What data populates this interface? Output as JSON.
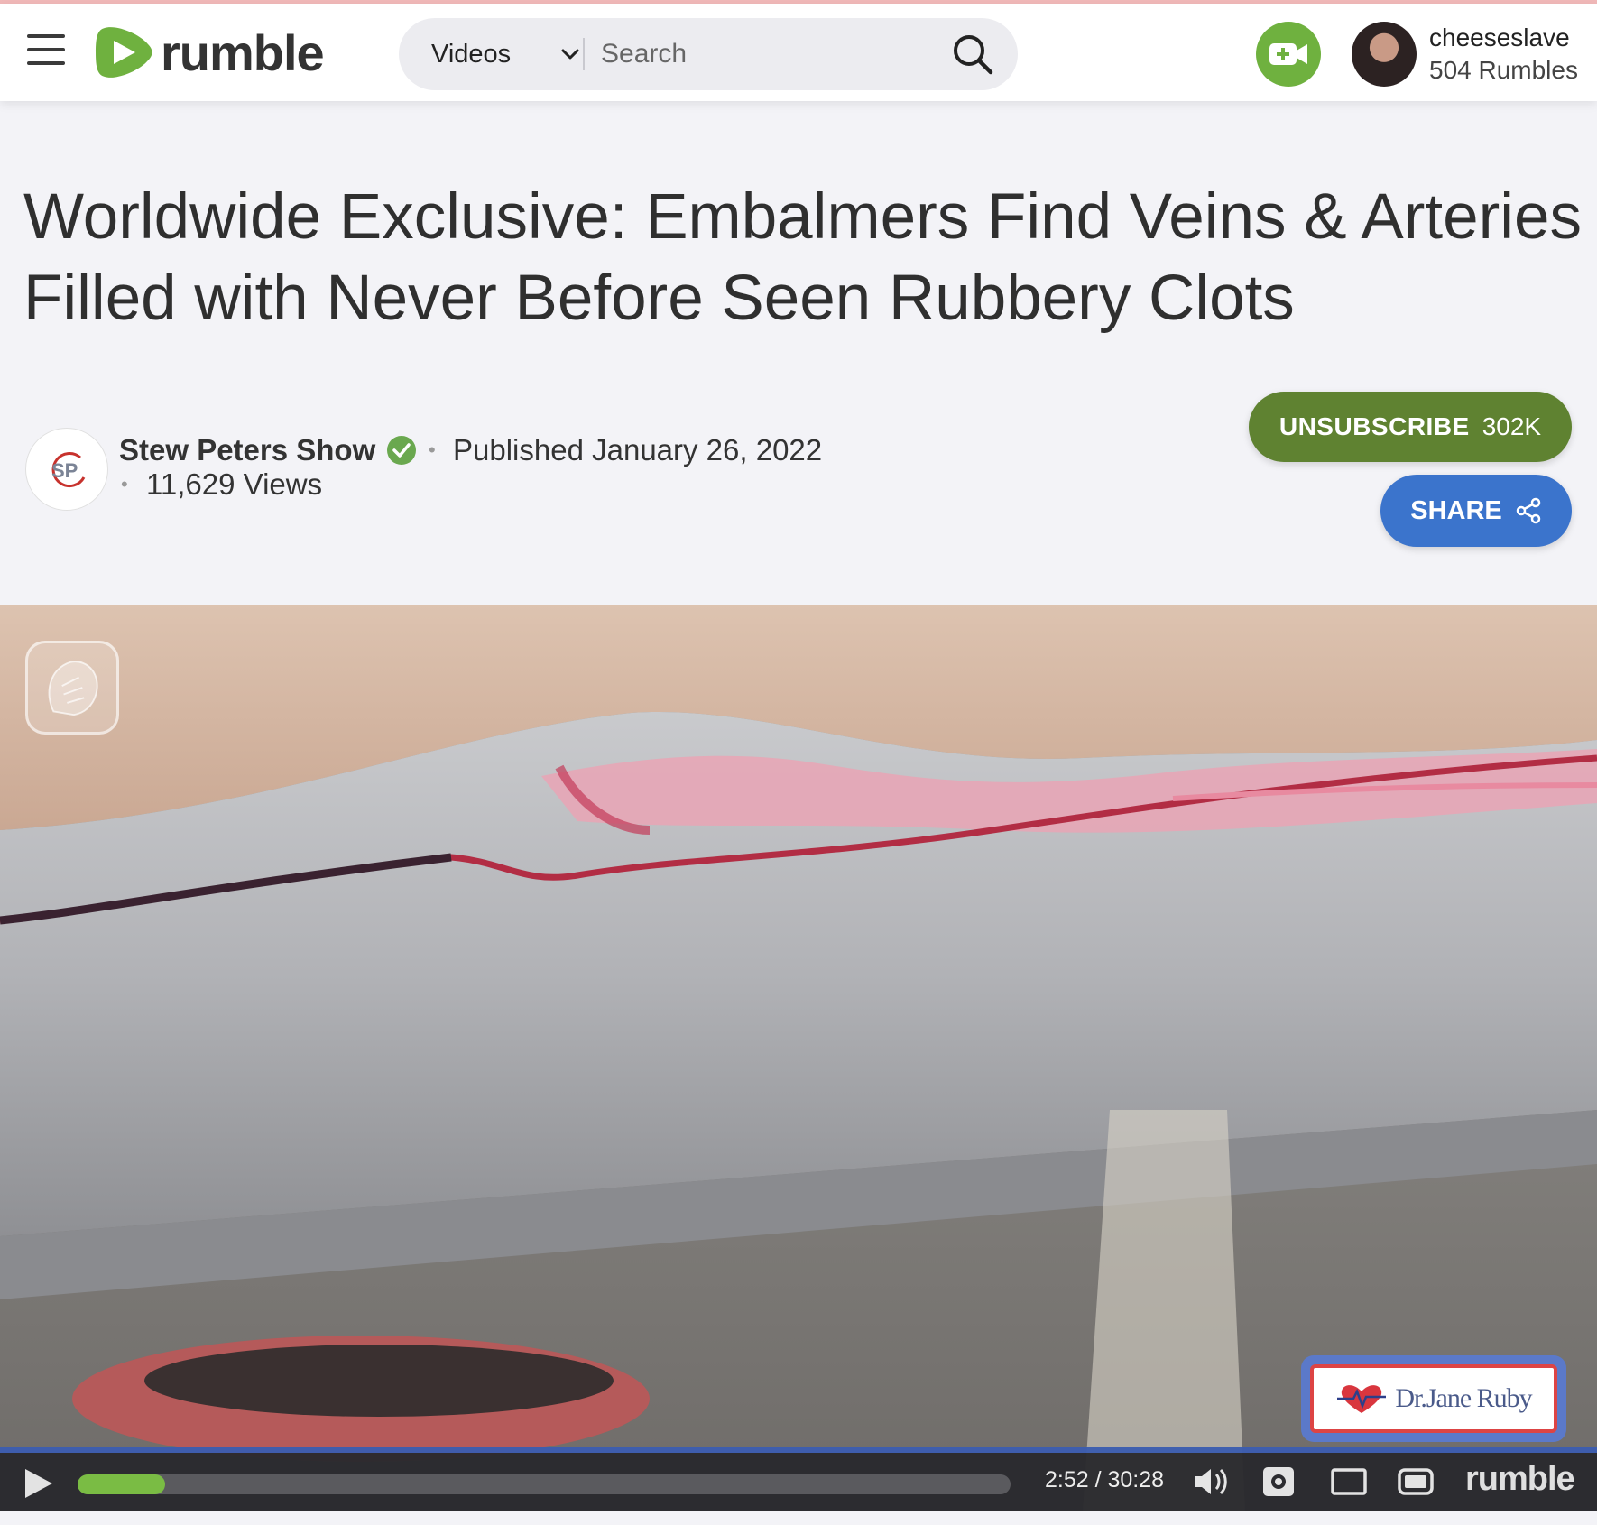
{
  "header": {
    "logo_text": "rumble",
    "search_category": "Videos",
    "search_placeholder": "Search",
    "user_name": "cheeseslave",
    "user_rumbles": "504 Rumbles"
  },
  "video": {
    "title": "Worldwide Exclusive: Embalmers Find Veins & Arteries Filled with Never Before Seen Rubbery Clots",
    "channel_name": "Stew Peters Show",
    "published": "Published January 26, 2022",
    "views": "11,629 Views",
    "unsubscribe_label": "UNSUBSCRIBE",
    "subscriber_count": "302K",
    "share_label": "SHARE",
    "overlay_brand": "Dr.Jane Ruby"
  },
  "player": {
    "time": "2:52 / 30:28",
    "progress": 0.094,
    "logo_text": "rumble"
  },
  "colors": {
    "brand_green": "#6fb13f",
    "unsubscribe_green": "#5f8231",
    "share_blue": "#3b74cc",
    "progress_green": "#7bc043"
  }
}
